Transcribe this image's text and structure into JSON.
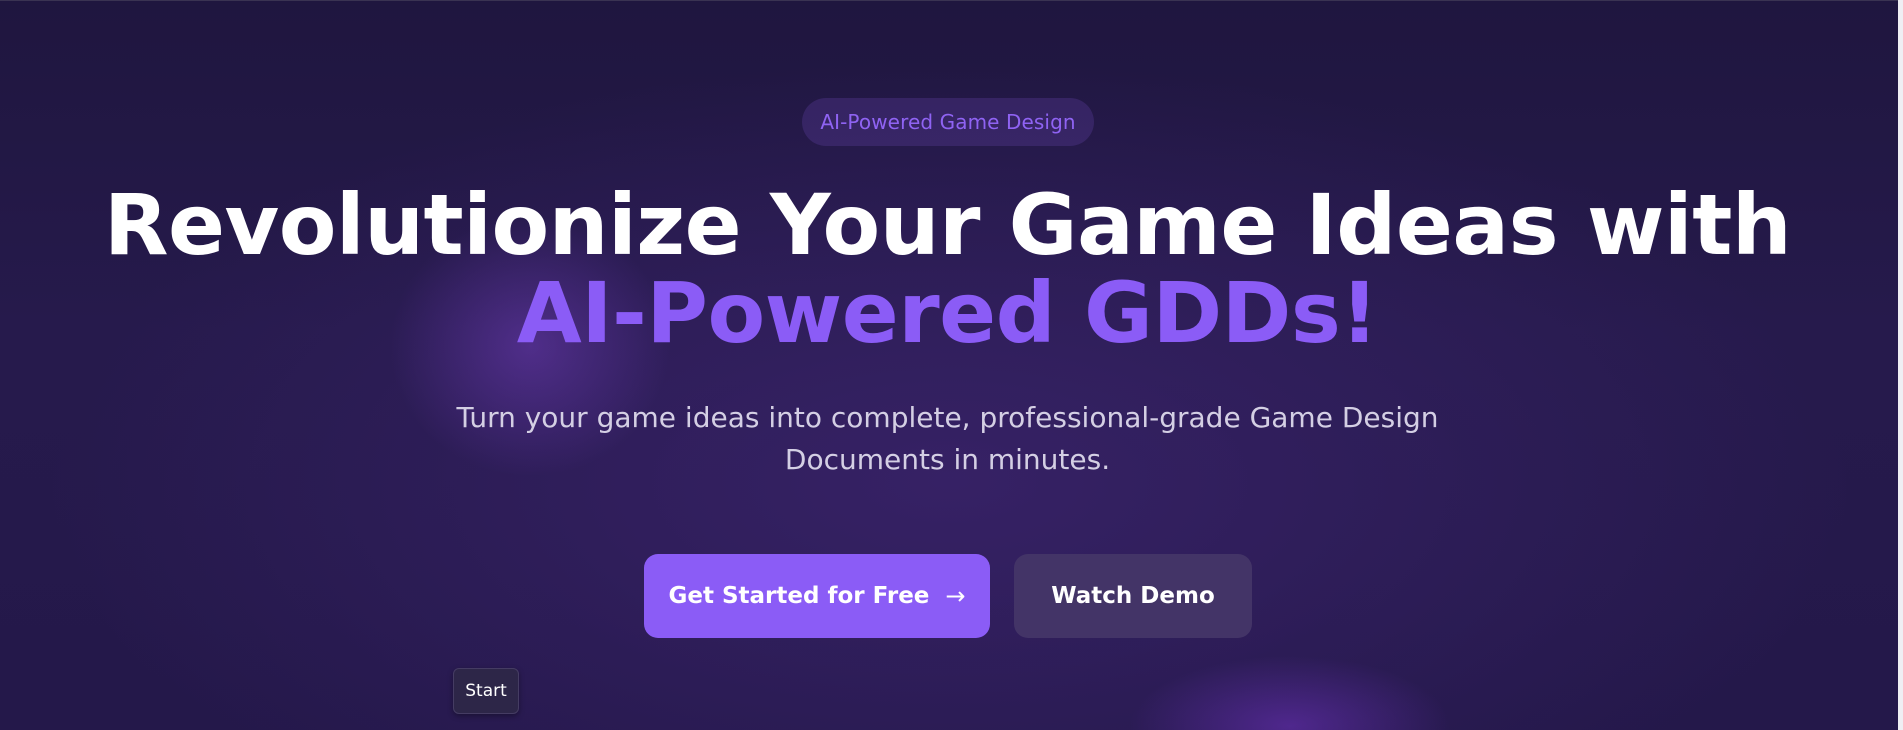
{
  "hero": {
    "badge": "AI-Powered Game Design",
    "headline_main": "Revolutionize Your Game Ideas with ",
    "headline_accent": "AI-Powered GDDs!",
    "subtitle": "Turn your game ideas into complete, professional-grade Game Design Documents in minutes.",
    "primary_button": "Get Started for Free",
    "primary_button_icon": "→",
    "secondary_button": "Watch Demo"
  },
  "tooltip": {
    "label": "Start"
  },
  "colors": {
    "accent": "#8b5cf6",
    "background": "#1d1638",
    "secondary_button": "#433467"
  },
  "icons": {
    "primary_button_icon": "arrow-right-icon"
  }
}
